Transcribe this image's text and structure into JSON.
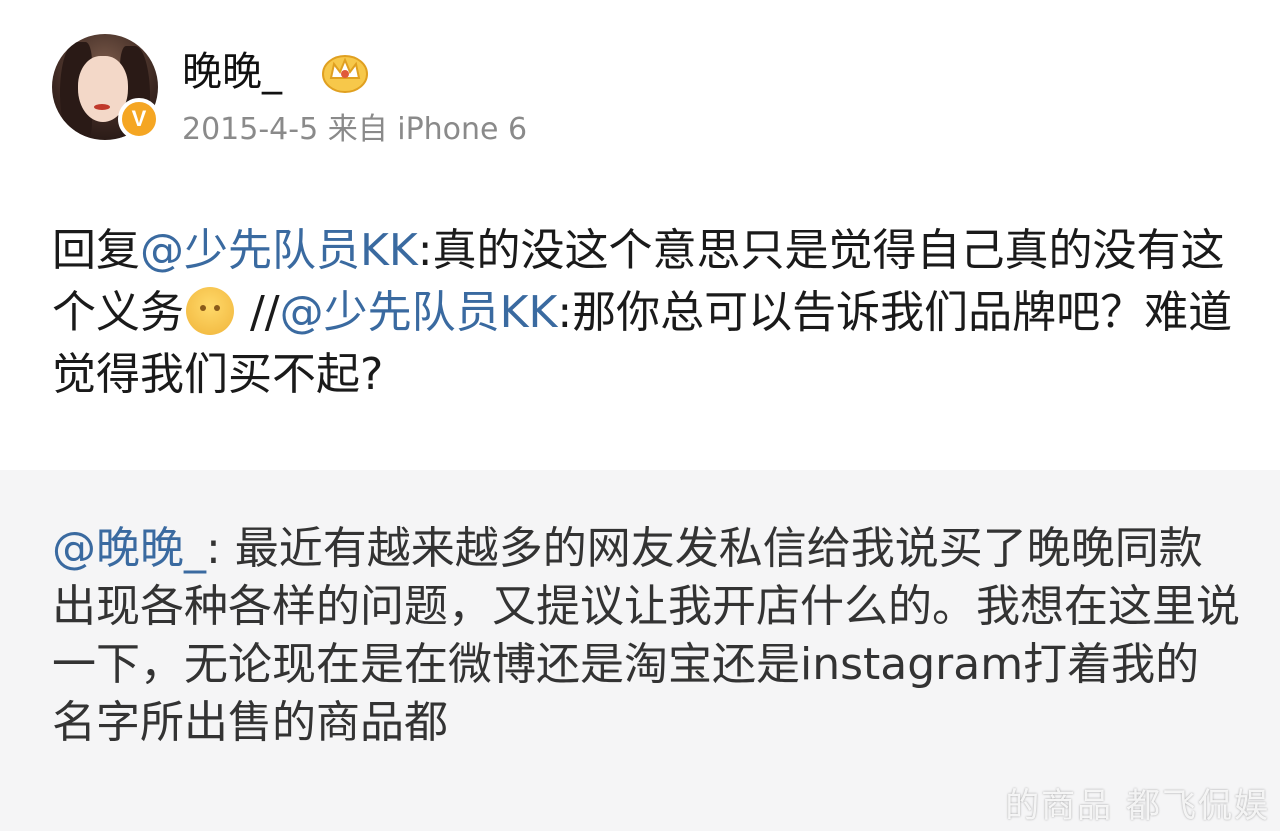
{
  "post": {
    "username": "晚晚_",
    "verified_badge": "V",
    "meta": "2015-4-5 来自 iPhone 6",
    "reply_prefix": "回复",
    "mention_1": "@少先队员KK",
    "text_1": ":真的没这个意思只是觉得自己真的没有这个义务",
    "emoji": "sad-face-emoji",
    "separator": " //",
    "mention_2": "@少先队员KK",
    "text_2": ":那你总可以告诉我们品牌吧？难道觉得我们买不起?"
  },
  "quote": {
    "mention": "@晚晚_",
    "text": ": 最近有越来越多的网友发私信给我说买了晚晚同款出现各种各样的问题，又提议让我开店什么的。我想在这里说一下，无论现在是在微博还是淘宝还是instagram打着我的名字所出售的商品都"
  },
  "watermark": "的商品  都飞侃娱",
  "colors": {
    "mention": "#3a6aa0",
    "badge": "#f5a623",
    "quote_bg": "#f5f5f6",
    "meta": "#8a8a8a"
  }
}
